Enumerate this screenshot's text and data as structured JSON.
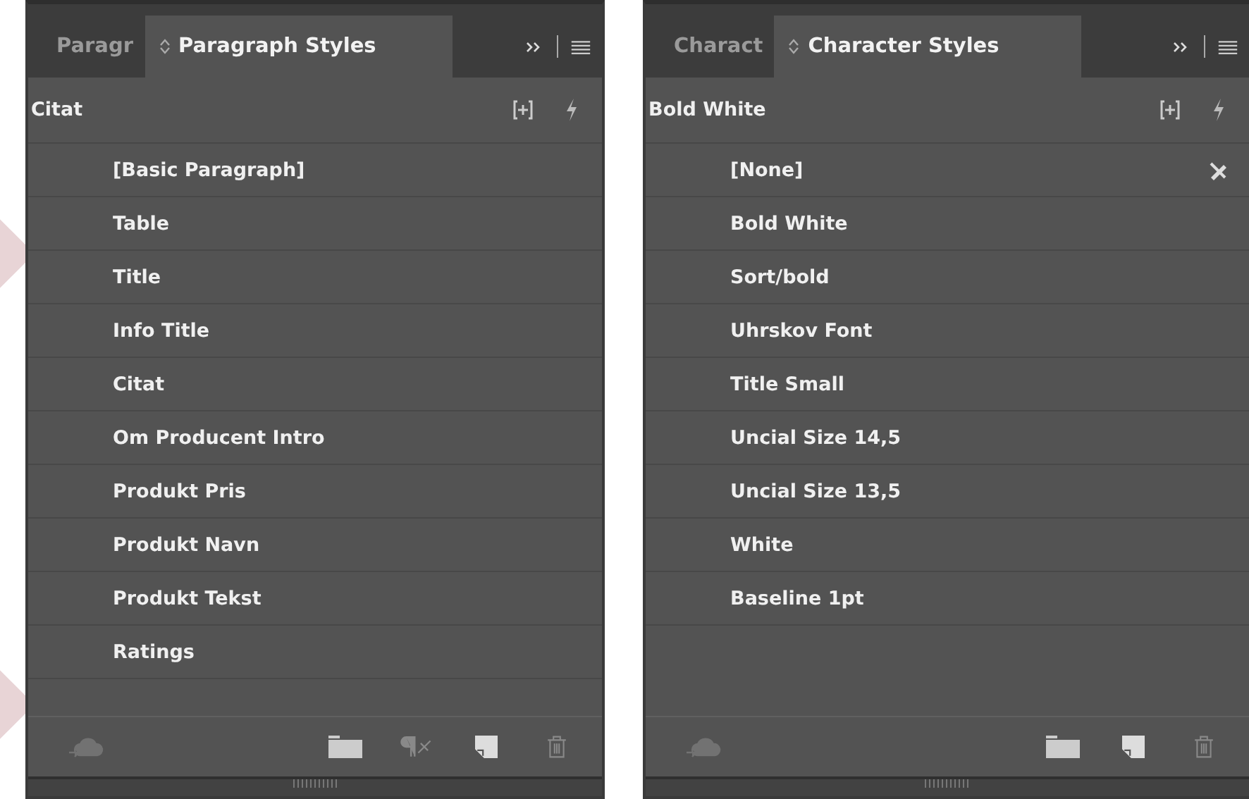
{
  "panels": [
    {
      "tabs": [
        {
          "label": "Paragr",
          "selected": false
        },
        {
          "label": "Paragraph Styles",
          "selected": true
        }
      ],
      "current_style": "Citat",
      "items": [
        {
          "name": "[Basic Paragraph]",
          "locked": false
        },
        {
          "name": "Table",
          "locked": false
        },
        {
          "name": "Title",
          "locked": false
        },
        {
          "name": "Info Title",
          "locked": false
        },
        {
          "name": "Citat",
          "locked": false
        },
        {
          "name": "Om Producent Intro",
          "locked": false
        },
        {
          "name": "Produkt Pris",
          "locked": false
        },
        {
          "name": "Produkt Navn",
          "locked": false
        },
        {
          "name": "Produkt Tekst",
          "locked": false
        },
        {
          "name": "Ratings",
          "locked": false
        }
      ],
      "footer_buttons": [
        {
          "kind": "cloud",
          "disabled": true
        },
        {
          "kind": "folder",
          "disabled": false
        },
        {
          "kind": "clear-overrides",
          "disabled": true
        },
        {
          "kind": "new",
          "disabled": false
        },
        {
          "kind": "delete",
          "disabled": true
        }
      ]
    },
    {
      "tabs": [
        {
          "label": "Charact",
          "selected": false
        },
        {
          "label": "Character Styles",
          "selected": true
        }
      ],
      "current_style": "Bold White",
      "items": [
        {
          "name": "[None]",
          "locked": true
        },
        {
          "name": "Bold White",
          "locked": false
        },
        {
          "name": "Sort/bold",
          "locked": false
        },
        {
          "name": "Uhrskov Font",
          "locked": false
        },
        {
          "name": "Title Small",
          "locked": false
        },
        {
          "name": "Uncial Size 14,5",
          "locked": false
        },
        {
          "name": "Uncial Size 13,5",
          "locked": false
        },
        {
          "name": "White",
          "locked": false
        },
        {
          "name": "Baseline 1pt",
          "locked": false
        }
      ],
      "footer_buttons": [
        {
          "kind": "cloud",
          "disabled": true
        },
        {
          "kind": "folder",
          "disabled": false
        },
        {
          "kind": "new",
          "disabled": false
        },
        {
          "kind": "delete",
          "disabled": true
        }
      ]
    }
  ]
}
